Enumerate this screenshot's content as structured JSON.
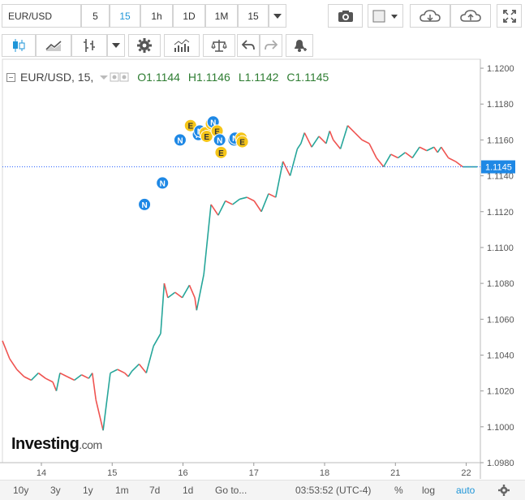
{
  "toolbar": {
    "symbol": "EUR/USD",
    "intervals": [
      "5",
      "15",
      "1h",
      "1D",
      "1M"
    ],
    "active_interval": "15",
    "interval_select": "15"
  },
  "legend": {
    "title": "EUR/USD, 15,",
    "open": "O1.1144",
    "high": "H1.1146",
    "low": "L1.1142",
    "close": "C1.1145"
  },
  "brand": {
    "name": "Investing",
    "suffix": ".com"
  },
  "bottom_bar": {
    "ranges": [
      "10y",
      "3y",
      "1y",
      "1m",
      "7d",
      "1d"
    ],
    "goto": "Go to...",
    "clock": "03:53:52 (UTC-4)",
    "pct": "%",
    "log": "log",
    "auto": "auto"
  },
  "colors": {
    "up": "#26a69a",
    "down": "#ef5350",
    "accent": "#1e95d8",
    "news": "#1e88e5",
    "event": "#f5c518"
  },
  "chart_data": {
    "type": "line",
    "series": [
      {
        "name": "EUR/USD, 15",
        "x": [
          0.0,
          0.2,
          0.4,
          0.6,
          0.8,
          1.0,
          1.2,
          1.4,
          1.5,
          1.6,
          1.8,
          2.0,
          2.2,
          2.4,
          2.5,
          2.6,
          2.8,
          3.0,
          3.2,
          3.4,
          3.5,
          3.6,
          3.8,
          4.0,
          4.2,
          4.4,
          4.5,
          4.6,
          4.8,
          5.0,
          5.2,
          5.35,
          5.4,
          5.6,
          5.8,
          6.0,
          6.2,
          6.4,
          6.6,
          6.8,
          7.0,
          7.2,
          7.4,
          7.6,
          7.8,
          8.0,
          8.2,
          8.3,
          8.4,
          8.6,
          8.8,
          9.0,
          9.1,
          9.2,
          9.4,
          9.6,
          9.8,
          10.0,
          10.2,
          10.4,
          10.6,
          10.8,
          11.0,
          11.2,
          11.4,
          11.6,
          11.8,
          12.0,
          12.1,
          12.2,
          12.4,
          12.6,
          12.8,
          13.0,
          13.2
        ],
        "values": [
          1.1048,
          1.1038,
          1.1032,
          1.1028,
          1.1026,
          1.103,
          1.1027,
          1.1025,
          1.102,
          1.103,
          1.1028,
          1.1026,
          1.1029,
          1.1027,
          1.103,
          1.1015,
          1.0998,
          1.103,
          1.1032,
          1.103,
          1.1028,
          1.1031,
          1.1035,
          1.103,
          1.1045,
          1.1052,
          1.108,
          1.1072,
          1.1075,
          1.1072,
          1.1079,
          1.1072,
          1.1065,
          1.1085,
          1.1124,
          1.1118,
          1.1126,
          1.1124,
          1.1127,
          1.1128,
          1.1126,
          1.112,
          1.113,
          1.1128,
          1.1148,
          1.114,
          1.1155,
          1.1158,
          1.1164,
          1.1156,
          1.1162,
          1.1158,
          1.1165,
          1.116,
          1.1155,
          1.1168,
          1.1164,
          1.116,
          1.1158,
          1.115,
          1.1145,
          1.1152,
          1.115,
          1.1153,
          1.115,
          1.1156,
          1.1154,
          1.1156,
          1.1153,
          1.1156,
          1.115,
          1.1148,
          1.1145,
          1.1145,
          1.1145
        ]
      }
    ],
    "last_price": 1.1145,
    "last_price_label": "1.1145",
    "ylim": [
      1.098,
      1.1205
    ],
    "y_ticks": [
      "1.1200",
      "1.1180",
      "1.1160",
      "1.1140",
      "1.1120",
      "1.1100",
      "1.1080",
      "1.1060",
      "1.1040",
      "1.1020",
      "1.1000",
      "1.0980"
    ],
    "y_tick_values": [
      1.12,
      1.118,
      1.116,
      1.114,
      1.112,
      1.11,
      1.108,
      1.106,
      1.104,
      1.102,
      1.1,
      1.098
    ],
    "x_ticks": [
      "14",
      "15",
      "16",
      "17",
      "18",
      "21",
      "22"
    ],
    "x_tick_values": [
      0.5,
      1.5,
      2.5,
      3.5,
      4.5,
      5.5,
      6.5
    ],
    "xlim": [
      0,
      6.75
    ],
    "x_tick_map": [
      0.55,
      1.55,
      2.55,
      3.55,
      4.55,
      5.55,
      6.55
    ],
    "markers": [
      {
        "label": "N",
        "kind": "news",
        "x": 3.95,
        "y": 1.1124
      },
      {
        "label": "N",
        "kind": "news",
        "x": 4.45,
        "y": 1.1136
      },
      {
        "label": "N",
        "kind": "news",
        "x": 4.94,
        "y": 1.116
      },
      {
        "label": "E",
        "kind": "event",
        "x": 5.23,
        "y": 1.1168
      },
      {
        "label": "N",
        "kind": "news",
        "x": 5.45,
        "y": 1.1163
      },
      {
        "label": "N",
        "kind": "news",
        "x": 5.49,
        "y": 1.1165
      },
      {
        "label": "F",
        "kind": "event",
        "x": 5.64,
        "y": 1.1164
      },
      {
        "label": "E",
        "kind": "event",
        "x": 5.68,
        "y": 1.1162
      },
      {
        "label": "E",
        "kind": "event",
        "x": 5.81,
        "y": 1.1169
      },
      {
        "label": "N",
        "kind": "news",
        "x": 5.86,
        "y": 1.117
      },
      {
        "label": "E",
        "kind": "event",
        "x": 5.97,
        "y": 1.1165
      },
      {
        "label": "N",
        "kind": "news",
        "x": 6.04,
        "y": 1.116
      },
      {
        "label": "E",
        "kind": "event",
        "x": 6.08,
        "y": 1.1153
      },
      {
        "label": "N",
        "kind": "news",
        "x": 6.44,
        "y": 1.116
      },
      {
        "label": "N",
        "kind": "news",
        "x": 6.47,
        "y": 1.1161
      },
      {
        "label": "E",
        "kind": "event",
        "x": 6.64,
        "y": 1.1161
      },
      {
        "label": "E",
        "kind": "event",
        "x": 6.67,
        "y": 1.1159
      }
    ]
  }
}
